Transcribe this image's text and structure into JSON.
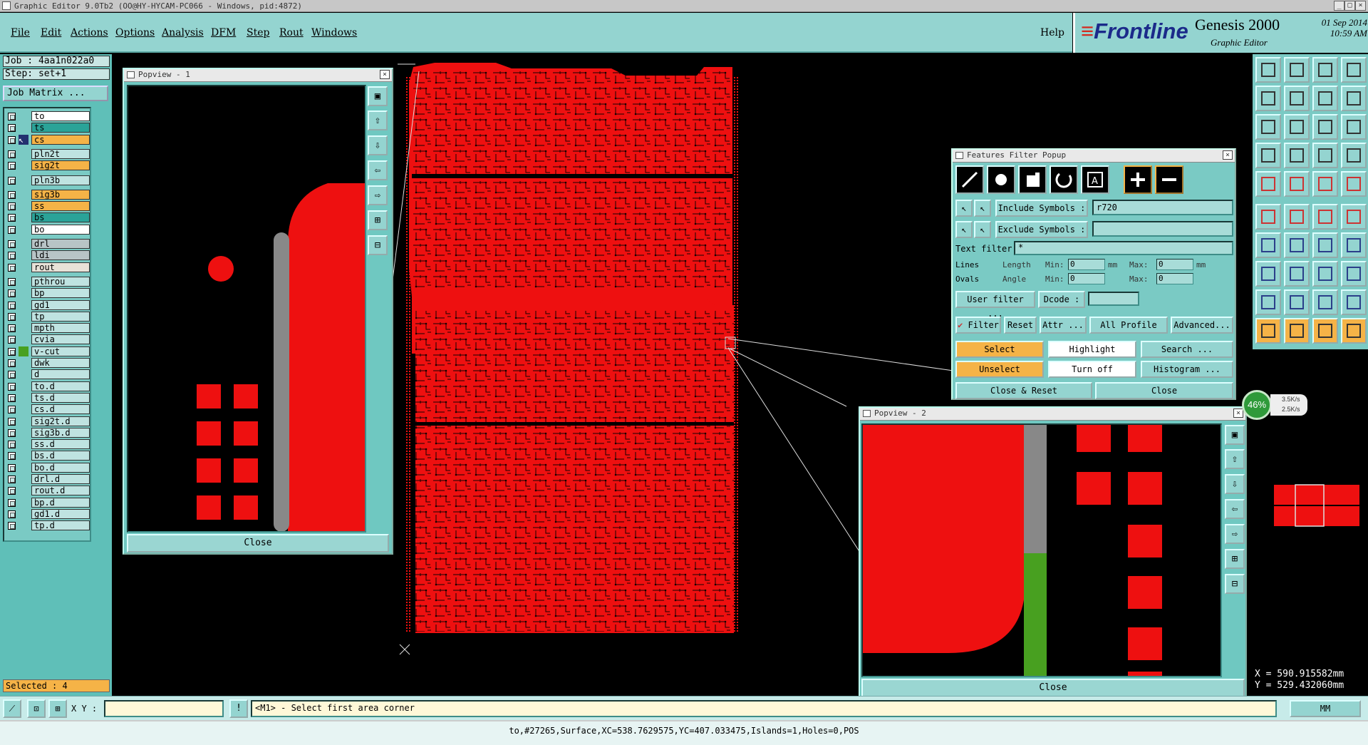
{
  "window": {
    "title": "Graphic Editor 9.0Tb2 (OO@HY-HYCAM-PC066 - Windows, pid:4872)"
  },
  "menu": {
    "file": "File",
    "edit": "Edit",
    "actions": "Actions",
    "options": "Options",
    "analysis": "Analysis",
    "dfm": "DFM",
    "step": "Step",
    "rout": "Rout",
    "windows": "Windows",
    "help": "Help"
  },
  "brand": {
    "logo_prefix": "≡",
    "logo": "Frontline",
    "product": "Genesis 2000",
    "subtitle": "Graphic Editor",
    "date": "01 Sep 2014",
    "time": "10:59 AM"
  },
  "job": {
    "job": "Job : 4aa1n022a0",
    "step": "Step: set+1",
    "matrix_btn": "Job Matrix ..."
  },
  "layers": [
    {
      "name": "to",
      "color": "#ffffff"
    },
    {
      "name": "ts",
      "color": "#2aa398"
    },
    {
      "name": "cs",
      "color": "#f5b347"
    },
    {
      "name": "pln2t",
      "color": "#bfe3e1"
    },
    {
      "name": "sig2t",
      "color": "#f5b347"
    },
    {
      "name": "pln3b",
      "color": "#bfe3e1"
    },
    {
      "name": "sig3b",
      "color": "#f5b347"
    },
    {
      "name": "ss",
      "color": "#f5b347"
    },
    {
      "name": "bs",
      "color": "#2aa398"
    },
    {
      "name": "bo",
      "color": "#ffffff"
    },
    {
      "name": "drl",
      "color": "#b8c4c6"
    },
    {
      "name": "ldi",
      "color": "#b8c4c6"
    },
    {
      "name": "rout",
      "color": "#e8e2d8"
    },
    {
      "name": "pthrou",
      "color": "#bfe3e1"
    },
    {
      "name": "bp",
      "color": "#bfe3e1"
    },
    {
      "name": "gd1",
      "color": "#bfe3e1"
    },
    {
      "name": "tp",
      "color": "#bfe3e1"
    },
    {
      "name": "mpth",
      "color": "#bfe3e1"
    },
    {
      "name": "cvia",
      "color": "#bfe3e1"
    },
    {
      "name": "v-cut",
      "color": "#bfe3e1"
    },
    {
      "name": "dwk",
      "color": "#bfe3e1"
    },
    {
      "name": "d",
      "color": "#bfe3e1"
    },
    {
      "name": "to.d",
      "color": "#bfe3e1"
    },
    {
      "name": "ts.d",
      "color": "#bfe3e1"
    },
    {
      "name": "cs.d",
      "color": "#bfe3e1"
    },
    {
      "name": "sig2t.d",
      "color": "#bfe3e1"
    },
    {
      "name": "sig3b.d",
      "color": "#bfe3e1"
    },
    {
      "name": "ss.d",
      "color": "#bfe3e1"
    },
    {
      "name": "bs.d",
      "color": "#bfe3e1"
    },
    {
      "name": "bo.d",
      "color": "#bfe3e1"
    },
    {
      "name": "drl.d",
      "color": "#bfe3e1"
    },
    {
      "name": "rout.d",
      "color": "#bfe3e1"
    },
    {
      "name": "bp.d",
      "color": "#bfe3e1"
    },
    {
      "name": "gd1.d",
      "color": "#bfe3e1"
    },
    {
      "name": "tp.d",
      "color": "#bfe3e1"
    }
  ],
  "selected_count": "Selected : 4",
  "popview1": {
    "title": "Popview - 1",
    "close": "Close"
  },
  "popview2": {
    "title": "Popview - 2",
    "close": "Close"
  },
  "features_filter": {
    "title": "Features Filter Popup",
    "include_label": "Include Symbols :",
    "include_value": "r720",
    "exclude_label": "Exclude Symbols :",
    "exclude_value": "",
    "text_filter_label": "Text filter",
    "text_filter_value": "*",
    "lines": "Lines",
    "ovals": "Ovals",
    "length": "Length",
    "angle": "Angle",
    "min": "Min:",
    "max": "Max:",
    "unit": "mm",
    "len_min": "0",
    "len_max": "0",
    "ang_min": "0",
    "ang_max": "0",
    "user_filter": "User filter ...",
    "dcode": "Dcode :",
    "dcode_value": "",
    "filter": "Filter",
    "reset": "Reset",
    "attr": "Attr ...",
    "profile": "All Profile",
    "advanced": "Advanced...",
    "select": "Select",
    "highlight": "Highlight",
    "search": "Search ...",
    "unselect": "Unselect",
    "turn_off": "Turn off",
    "histogram": "Histogram ...",
    "close_reset": "Close & Reset",
    "close": "Close"
  },
  "net_meter": {
    "percent": "46%",
    "up": "3.5K/s",
    "down": "2.5K/s"
  },
  "coords": {
    "x": "X = 590.915582mm",
    "y": "Y = 529.432060mm"
  },
  "command": {
    "xy_label": "X Y :",
    "xy_value": "",
    "prompt": "<M1> - Select first area corner",
    "units": "MM"
  },
  "status": "to,#27265,Surface,XC=538.7629575,YC=407.033475,Islands=1,Holes=0,POS",
  "colors": {
    "board": "#ee1010",
    "panel": "#94d4d0",
    "highlight": "#f5b347",
    "trace": "#000000"
  }
}
